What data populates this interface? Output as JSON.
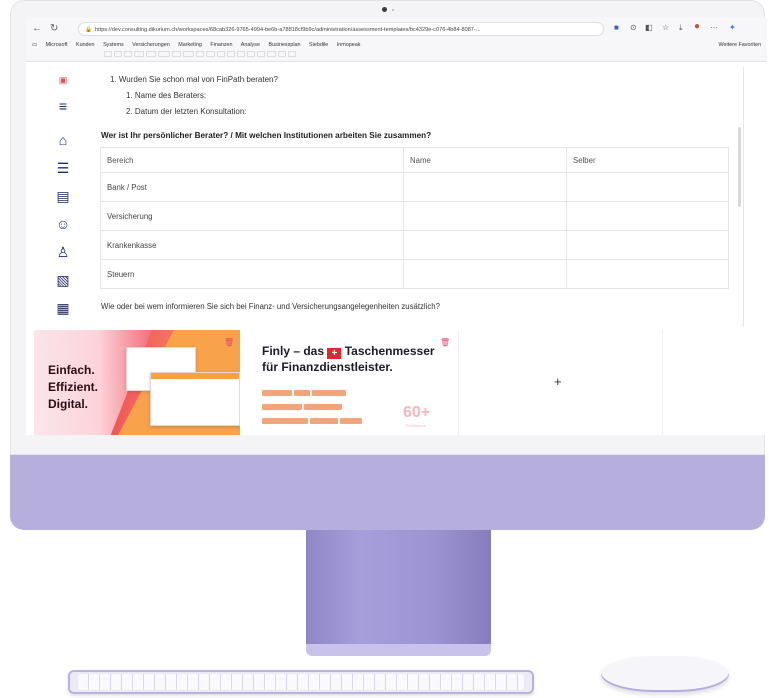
{
  "browser": {
    "url": "https://dev.consulting.dikurium.ch/workspaces/68cab326-9765-4994-be6b-a78818cf9b9c/administration/assessment-templates/bc4329e-c076-4b84-8087-...",
    "bookmarks": [
      "Microsoft",
      "Kunden",
      "Systems",
      "Versicherungen",
      "Marketing",
      "Finanzen",
      "Analyse",
      "Businessplan",
      "Siebdile",
      "Inmopeak"
    ],
    "bookmarks_right": "Weitere Favoriten",
    "nav_back": "←",
    "nav_reload": "↻"
  },
  "sidebar": {
    "icons": [
      "menu-icon",
      "home-icon",
      "checklist-icon",
      "document-icon",
      "users-icon",
      "user-search-icon",
      "clipboard-icon",
      "calculator-icon",
      "group-icon"
    ]
  },
  "form": {
    "q1": "1. Wurden Sie schon mal von FinPath beraten?",
    "q1_sub1": "1. Name des Beraters:",
    "q1_sub2": "2. Datum der letzten Konsultation:",
    "heading": "Wer ist Ihr persönlicher Berater? / Mit welchen Institutionen arbeiten Sie zusammen?",
    "table": {
      "headers": [
        "Bereich",
        "Name",
        "Selber"
      ],
      "rows": [
        "Bank / Post",
        "Versicherung",
        "Krankenkasse",
        "Steuern"
      ]
    },
    "footer_question": "Wie oder bei wem informieren Sie sich bei Finanz- und Versicherungsangelegenheiten zusätzlich?"
  },
  "ads": {
    "left_lines": [
      "Einfach.",
      "Effizient.",
      "Digital."
    ],
    "mid_title_part1": "Finly – das",
    "mid_title_flag": "+",
    "mid_title_part2": "Taschenmesser",
    "mid_title_line2": "für Finanzdienstleister.",
    "mid_big": "60+",
    "mid_big_sub": "Funktionen",
    "add_label": "+"
  },
  "colors": {
    "sidebar_icon": "#1f2d6b",
    "chin": "#b6aedd",
    "ad_red": "#d8234f",
    "ad_orange": "#f8a24b"
  }
}
